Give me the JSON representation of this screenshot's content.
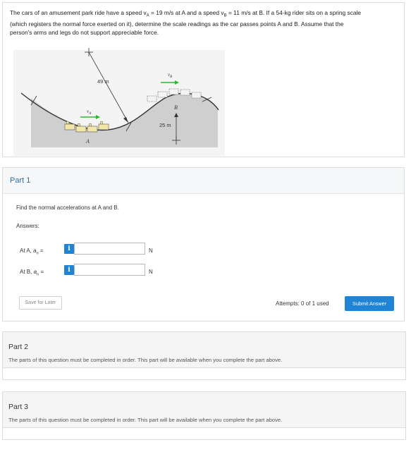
{
  "problem": {
    "line1_a": "The cars of an amusement park ride have a speed v",
    "sub_a": "A",
    "line1_b": " = 19 m/s at A and a speed v",
    "sub_b": "B",
    "line1_c": " = 11 m/s at B. If a 54-kg rider sits on a spring scale",
    "line2": "(which registers the normal force exerted on it), determine the scale readings as the car passes points A and B. Assume that the",
    "line3": "person's arms and legs do not support appreciable force."
  },
  "figure": {
    "radius_a": "49 m",
    "radius_b": "25 m",
    "label_va": "v",
    "label_va_sub": "A",
    "label_vb": "v",
    "label_vb_sub": "B",
    "label_a": "A",
    "label_b": "B"
  },
  "part1": {
    "title": "Part 1",
    "instruction": "Find the normal accelerations at A and B.",
    "answers_label": "Answers:",
    "rows": [
      {
        "label_pre": "At A,",
        "symbol": "a",
        "sub": "n",
        "eq": " =",
        "value": "",
        "unit": "N"
      },
      {
        "label_pre": "At B,",
        "symbol": "a",
        "sub": "n",
        "eq": " =",
        "value": "",
        "unit": "N"
      }
    ],
    "info_glyph": "i",
    "save_label": "Save for Later",
    "attempts": "Attempts: 0 of 1 used",
    "submit_label": "Submit Answer"
  },
  "part2": {
    "title": "Part 2",
    "message": "The parts of this question must be completed in order. This part will be available when you complete the part above."
  },
  "part3": {
    "title": "Part 3",
    "message": "The parts of this question must be completed in order. This part will be available when you complete the part above."
  },
  "colors": {
    "accent": "#1f83d6",
    "part_title": "#2e6da4",
    "velocity_arrow": "#2eb82e"
  }
}
